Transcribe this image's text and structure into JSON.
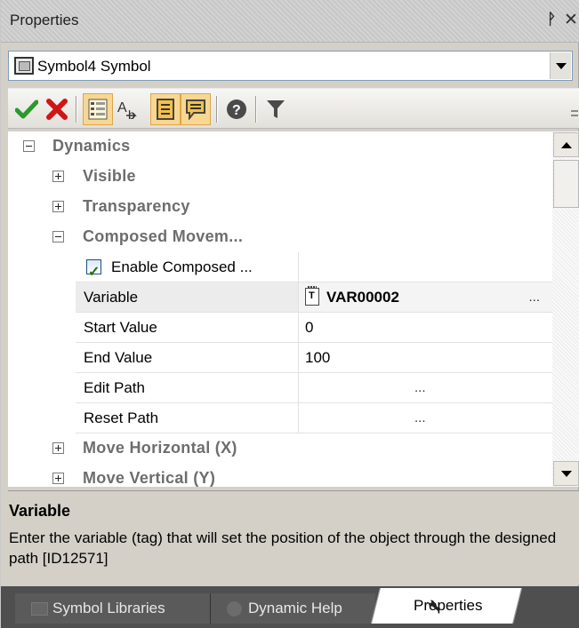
{
  "panel": {
    "title": "Properties",
    "pin_glyph": "ᚹ",
    "close_glyph": "✕"
  },
  "object_selector": {
    "value": "Symbol4 Symbol",
    "icon": "symbol-icon"
  },
  "toolbar": {
    "buttons": [
      {
        "name": "apply-button",
        "icon": "checkmark-icon",
        "color": "#2a9a2a",
        "active": false
      },
      {
        "name": "cancel-button",
        "icon": "red-x-icon",
        "color": "#d01515",
        "active": false
      },
      {
        "name": "categorized-view-button",
        "icon": "categorized-icon",
        "active": true
      },
      {
        "name": "alphabetical-view-button",
        "icon": "alphabetical-icon",
        "active": false
      },
      {
        "name": "description-toggle-button",
        "icon": "description-icon",
        "active": true
      },
      {
        "name": "comment-toggle-button",
        "icon": "comment-icon",
        "active": true
      },
      {
        "name": "help-button",
        "icon": "question-icon",
        "active": false
      },
      {
        "name": "filter-button",
        "icon": "filter-icon",
        "active": false
      }
    ]
  },
  "grid": {
    "dynamics": {
      "label": "Dynamics",
      "expanded": true
    },
    "visible": {
      "label": "Visible",
      "expanded": false
    },
    "transparency": {
      "label": "Transparency",
      "expanded": false
    },
    "composed": {
      "label": "Composed Movem...",
      "expanded": true
    },
    "enable_composed": {
      "label": "Enable Composed ...",
      "checked": true,
      "value": ""
    },
    "variable": {
      "label": "Variable",
      "value": "VAR00002",
      "button": "..."
    },
    "start_value": {
      "label": "Start Value",
      "value": "0"
    },
    "end_value": {
      "label": "End Value",
      "value": "100"
    },
    "edit_path": {
      "label": "Edit Path",
      "button": "..."
    },
    "reset_path": {
      "label": "Reset Path",
      "button": "..."
    },
    "move_horizontal": {
      "label": "Move Horizontal (X)",
      "expanded": false
    },
    "move_vertical": {
      "label": "Move Vertical (Y)",
      "expanded": false
    }
  },
  "help": {
    "title": "Variable",
    "text": "Enter the variable (tag) that will set the position of the object through the designed path [ID12571]"
  },
  "tabs": [
    {
      "label": "Symbol Libraries",
      "icon": "library-icon",
      "active": false
    },
    {
      "label": "Dynamic Help",
      "icon": "help-icon",
      "active": false
    },
    {
      "label": "Properties",
      "icon": "wrench-icon",
      "active": true
    }
  ],
  "colors": {
    "selection": "#f7d793",
    "category_text": "#6d6d6d",
    "panel_bg": "#d4d0c8",
    "tab_strip": "#4f4f4f"
  }
}
